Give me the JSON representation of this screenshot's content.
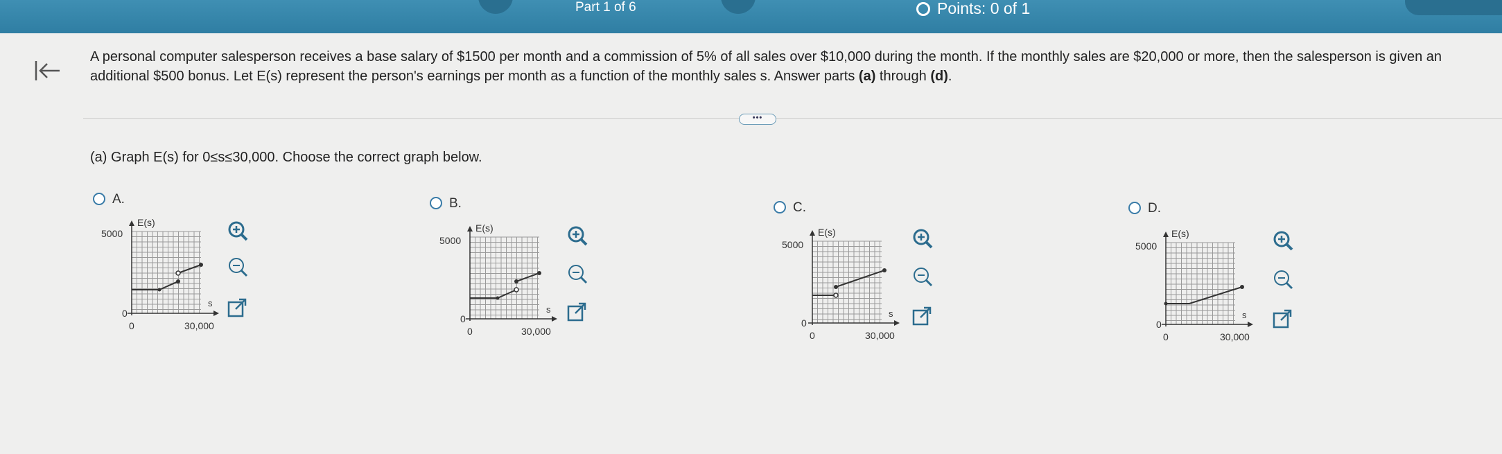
{
  "header": {
    "part": "Part 1 of 6",
    "points": "Points: 0 of 1"
  },
  "problem": {
    "text": "A personal computer salesperson receives a base salary of $1500 per month and a commission of 5% of all sales over $10,000 during the month. If the monthly sales are $20,000 or more, then the salesperson is given an additional $500 bonus. Let E(s) represent the person's earnings per month as a function of the monthly sales s. Answer parts",
    "part_a_bold": "(a)",
    "through": "through",
    "part_d_bold": "(d)",
    "end": "."
  },
  "more_button": "•••",
  "question": {
    "prefix": "(a)",
    "text": "Graph E(s) for 0≤s≤30,000. Choose the correct graph below."
  },
  "options": [
    {
      "label": "A.",
      "selected": false
    },
    {
      "label": "B.",
      "selected": false
    },
    {
      "label": "C.",
      "selected": false
    },
    {
      "label": "D.",
      "selected": false
    }
  ],
  "graph_labels": {
    "y_axis": "E(s)",
    "x_axis": "s",
    "y_max": "5000",
    "y_zero": "0",
    "x_zero": "0",
    "x_max": "30,000"
  },
  "tools": {
    "zoom_in": "zoom-in-icon",
    "zoom_out": "zoom-out-icon",
    "popout": "external-link-icon"
  },
  "colors": {
    "header": "#2f7ea3",
    "radio": "#3a7ca8",
    "grid": "#9a9a9a"
  }
}
